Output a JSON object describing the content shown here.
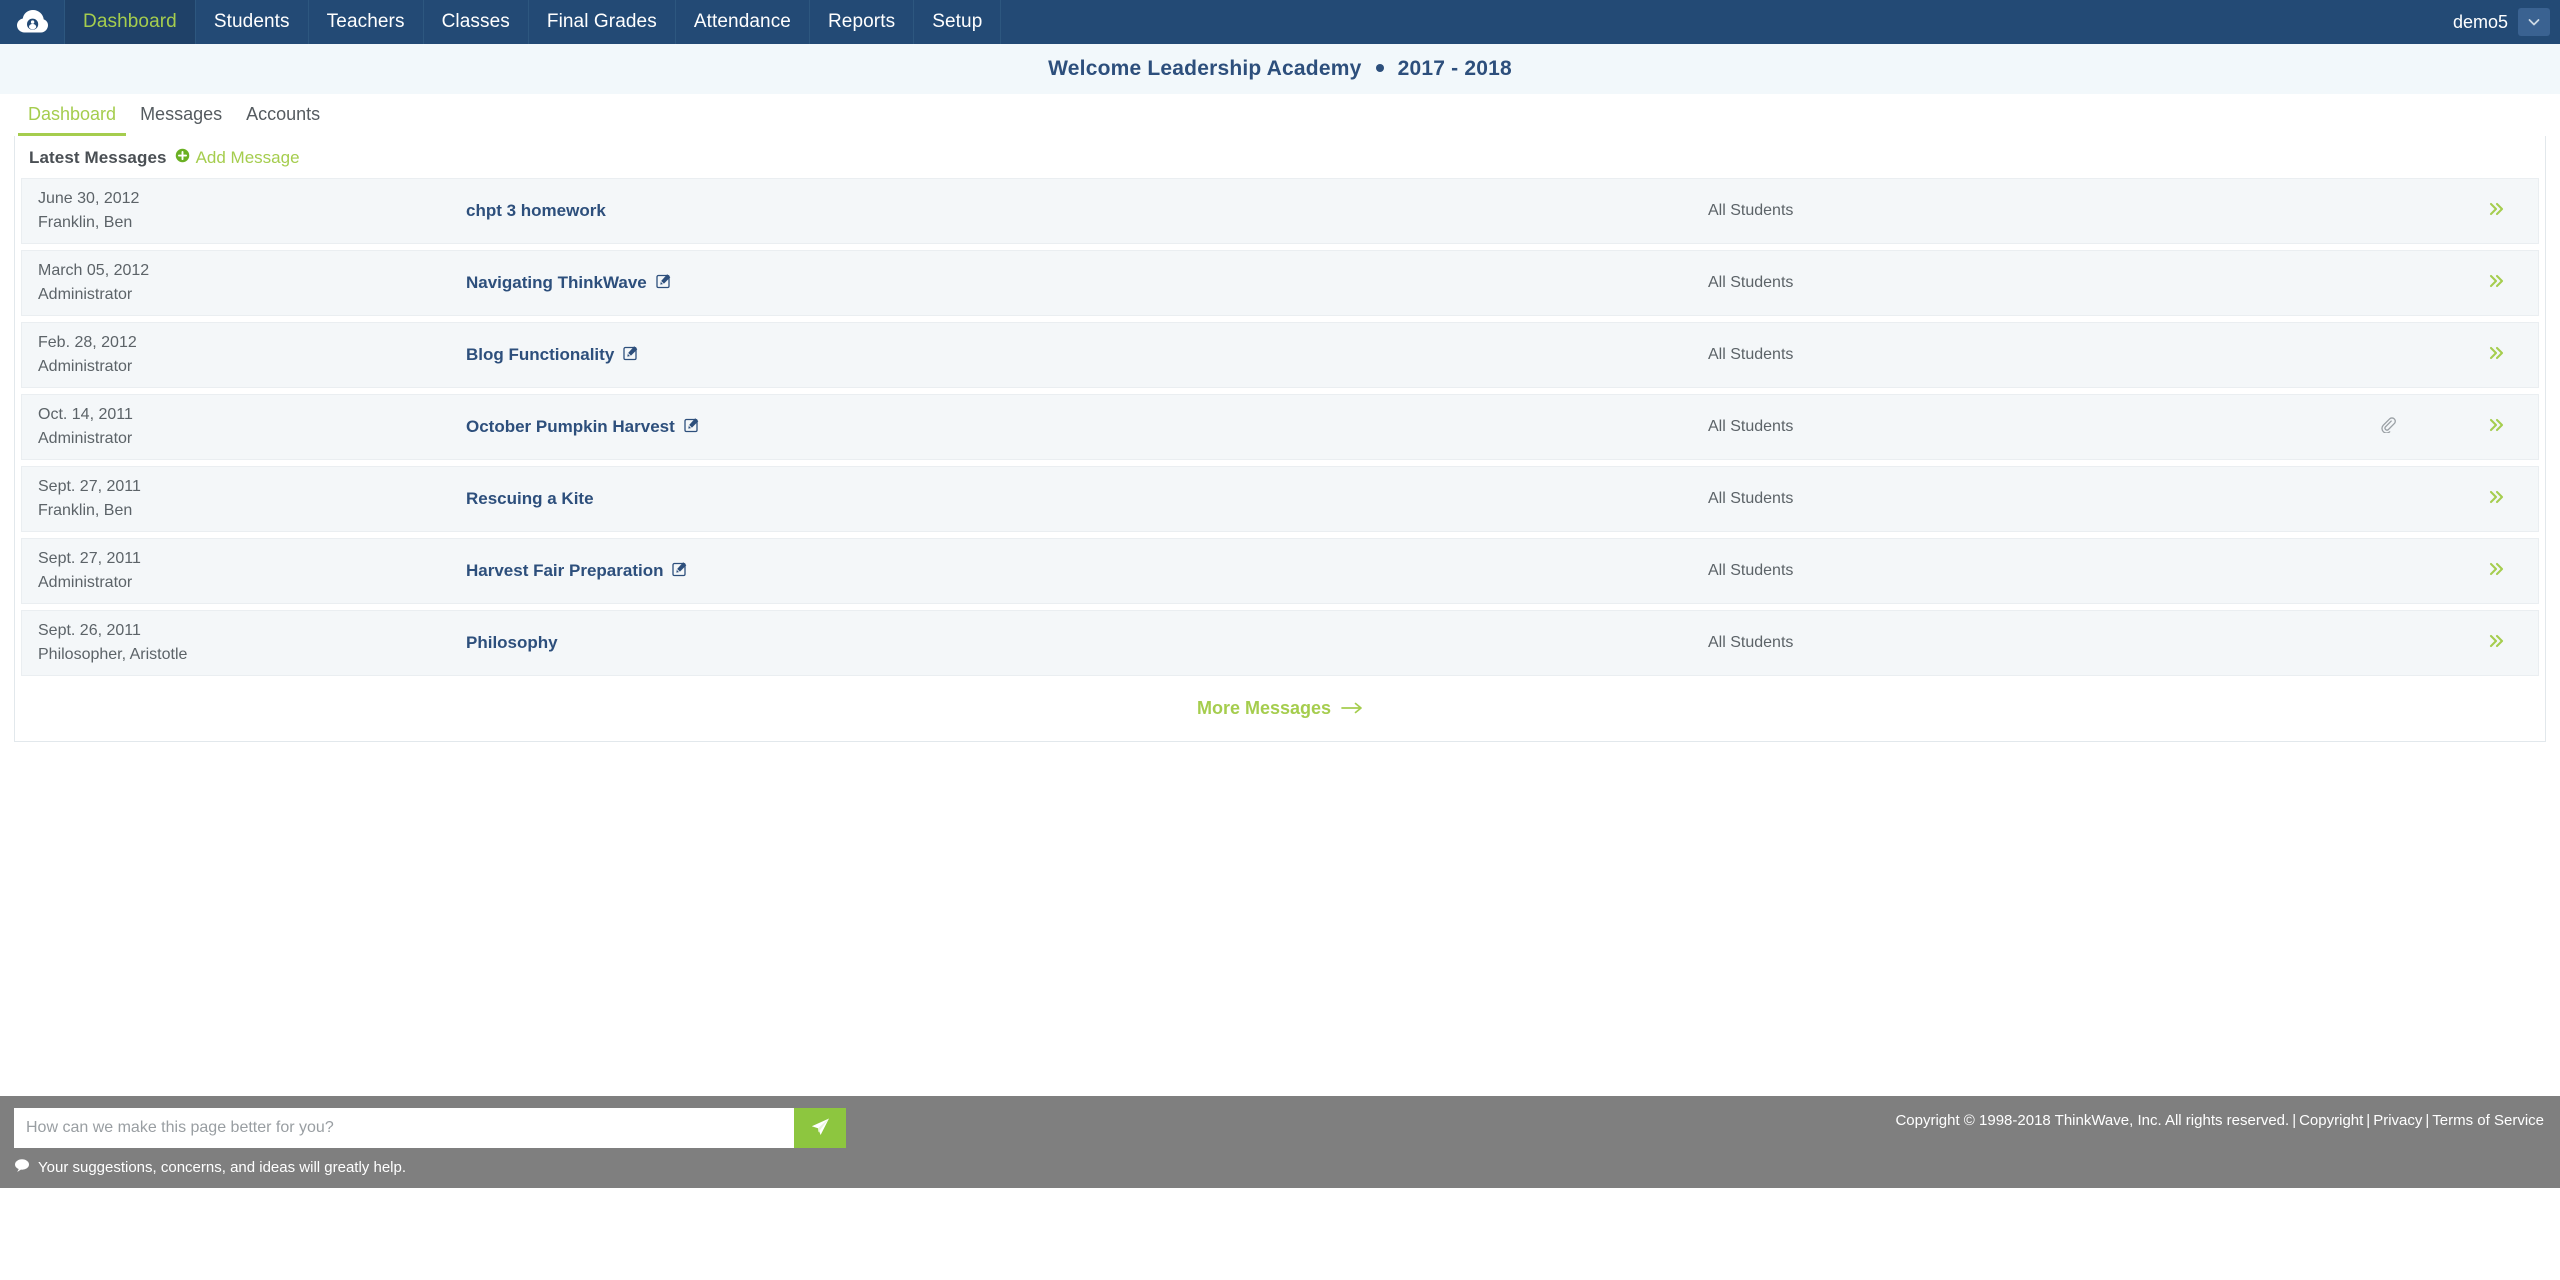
{
  "navbar": {
    "logo_icon": "cloud-person-logo",
    "items": [
      {
        "label": "Dashboard",
        "active": true
      },
      {
        "label": "Students",
        "active": false
      },
      {
        "label": "Teachers",
        "active": false
      },
      {
        "label": "Classes",
        "active": false
      },
      {
        "label": "Final Grades",
        "active": false
      },
      {
        "label": "Attendance",
        "active": false
      },
      {
        "label": "Reports",
        "active": false
      },
      {
        "label": "Setup",
        "active": false
      }
    ],
    "user": "demo5",
    "caret_icon": "chevron-down-icon",
    "bg_color": "#234a75",
    "active_color": "#a5cd4e"
  },
  "welcome": {
    "school": "Welcome Leadership Academy",
    "year": "2017 - 2018",
    "bg_color": "#f2f8fb",
    "text_color": "#2d4f7c"
  },
  "tabs": [
    {
      "label": "Dashboard",
      "active": true
    },
    {
      "label": "Messages",
      "active": false
    },
    {
      "label": "Accounts",
      "active": false
    }
  ],
  "card": {
    "title": "Latest Messages",
    "add_label": "Add Message",
    "add_icon": "plus-circle-icon",
    "more_label": "More Messages",
    "more_icon": "arrow-right-icon",
    "accent_color": "#a5cd4e"
  },
  "messages": [
    {
      "date": "June 30, 2012",
      "author": "Franklin, Ben",
      "title": "chpt 3 homework",
      "has_edit": false,
      "has_attachment": false,
      "audience": "All Students",
      "arrow_icon": "double-chevron-right-icon"
    },
    {
      "date": "March 05, 2012",
      "author": "Administrator",
      "title": "Navigating ThinkWave",
      "has_edit": true,
      "has_attachment": false,
      "audience": "All Students",
      "arrow_icon": "double-chevron-right-icon"
    },
    {
      "date": "Feb. 28, 2012",
      "author": "Administrator",
      "title": "Blog Functionality",
      "has_edit": true,
      "has_attachment": false,
      "audience": "All Students",
      "arrow_icon": "double-chevron-right-icon"
    },
    {
      "date": "Oct. 14, 2011",
      "author": "Administrator",
      "title": "October Pumpkin Harvest",
      "has_edit": true,
      "has_attachment": true,
      "audience": "All Students",
      "arrow_icon": "double-chevron-right-icon"
    },
    {
      "date": "Sept. 27, 2011",
      "author": "Franklin, Ben",
      "title": "Rescuing a Kite",
      "has_edit": false,
      "has_attachment": false,
      "audience": "All Students",
      "arrow_icon": "double-chevron-right-icon"
    },
    {
      "date": "Sept. 27, 2011",
      "author": "Administrator",
      "title": "Harvest Fair Preparation",
      "has_edit": true,
      "has_attachment": false,
      "audience": "All Students",
      "arrow_icon": "double-chevron-right-icon"
    },
    {
      "date": "Sept. 26, 2011",
      "author": "Philosopher, Aristotle",
      "title": "Philosophy",
      "has_edit": false,
      "has_attachment": false,
      "audience": "All Students",
      "arrow_icon": "double-chevron-right-icon"
    }
  ],
  "footer": {
    "feedback_placeholder": "How can we make this page better for you?",
    "feedback_value": "",
    "send_icon": "paper-plane-icon",
    "note_icon": "speech-bubble-icon",
    "note": "Your suggestions, concerns, and ideas will greatly help.",
    "copyright": "Copyright © 1998-2018 ThinkWave, Inc. All rights reserved.",
    "links": [
      "Copyright",
      "Privacy",
      "Terms of Service"
    ],
    "bg_color": "#7f7f7f",
    "send_color": "#8dc63f"
  }
}
